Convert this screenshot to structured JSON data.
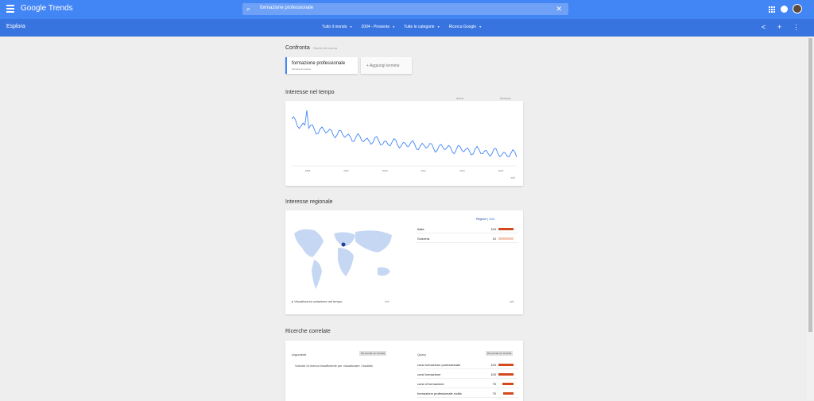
{
  "app": {
    "brand": "Google Trends"
  },
  "search": {
    "query": "formazione professionale"
  },
  "subbar": {
    "title": "Esplora",
    "filters": [
      "Tutto il mondo",
      "2004 - Presente",
      "Tutte le categorie",
      "Ricerca Google"
    ]
  },
  "compare": {
    "title": "Confronta",
    "hint": "Termini di ricerca",
    "term": "formazione professionale",
    "term_type": "Termine di ricerca",
    "add_term": "+ Aggiungi termine"
  },
  "interest_time": {
    "title": "Interesse nel tempo",
    "legend_left": "Notizie",
    "legend_right": "Previsione",
    "embed": "</>"
  },
  "chart_data": {
    "type": "line",
    "x": [
      "2006",
      "2007",
      "2009",
      "2011",
      "2013",
      "2015"
    ],
    "series": [
      {
        "values": [
          82,
          72,
          66,
          62,
          58,
          52,
          48,
          45,
          42,
          40,
          38,
          36,
          34,
          32,
          30,
          28,
          26,
          24,
          22,
          20
        ]
      }
    ],
    "ylim": [
      0,
      100
    ]
  },
  "regional": {
    "title": "Interesse regionale",
    "toggle_region": "Regione",
    "toggle_city": "Città",
    "rows": [
      {
        "label": "Italia",
        "value": "100"
      },
      {
        "label": "Svizzera",
        "value": "10"
      }
    ],
    "footer_text": "Visualizza la variazione nel tempo",
    "embed": "</>"
  },
  "related": {
    "title": "Ricerche correlate",
    "left_header": "Argomenti",
    "left_toggle": "Più cercati",
    "left_toggle2": "In crescita",
    "left_empty": "Volume di ricerca insufficiente per visualizzare i risultati.",
    "right_header": "Query",
    "right_toggle": "Più cercati",
    "right_toggle2": "In crescita",
    "queries": [
      {
        "label": "corsi formazione professionale",
        "value": "100"
      },
      {
        "label": "corsi formazione",
        "value": "100"
      },
      {
        "label": "corsi di formazione",
        "value": "75"
      },
      {
        "label": "formazione professionale sicilia",
        "value": "70"
      }
    ]
  }
}
